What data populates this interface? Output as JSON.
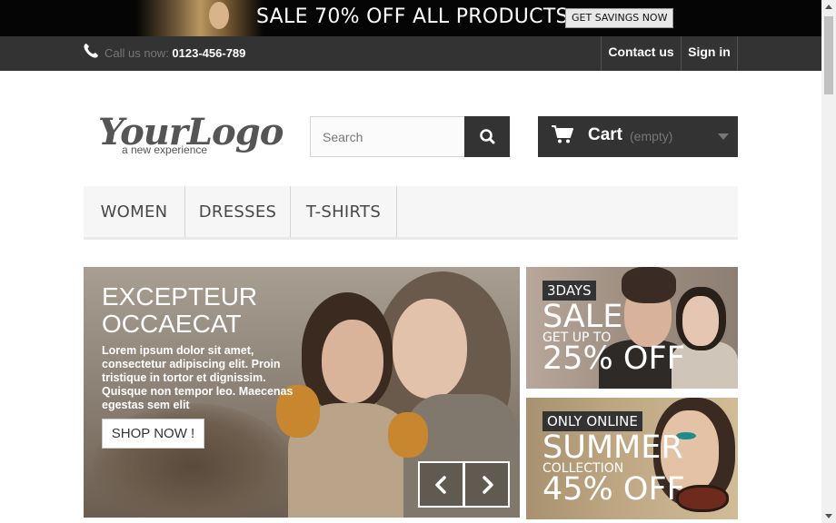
{
  "promo": {
    "text": "SALE 70% OFF ALL PRODUCTS",
    "button": "GET SAVINGS NOW"
  },
  "topnav": {
    "call_label": "Call us now: ",
    "phone_number": "0123-456-789",
    "contact": "Contact us",
    "signin": "Sign in"
  },
  "logo": {
    "name": "YourLogo",
    "tagline": "a new experience"
  },
  "search": {
    "placeholder": "Search"
  },
  "cart": {
    "label": "Cart",
    "status": "(empty)"
  },
  "menu": {
    "items": [
      "WOMEN",
      "DRESSES",
      "T-SHIRTS"
    ]
  },
  "hero": {
    "title_line1": "EXCEPTEUR",
    "title_line2": "OCCAECAT",
    "description": "Lorem ipsum dolor sit amet, consectetur adipiscing elit. Proin tristique in tortor et dignissim. Quisque non tempor leo. Maecenas egestas sem elit",
    "button": "SHOP NOW !"
  },
  "banners": [
    {
      "tag": "3DAYS",
      "headline": "SALE",
      "sub": "GET UP TO",
      "offer": "25% OFF"
    },
    {
      "tag": "ONLY ONLINE",
      "headline": "SUMMER",
      "sub": "COLLECTION",
      "offer": "45% OFF"
    }
  ],
  "colors": {
    "dark": "#333333",
    "menu_bg": "#f6f6f6",
    "promo_bg": "#050505"
  },
  "icons": [
    "phone-icon",
    "search-icon",
    "cart-icon",
    "chevron-down-icon",
    "chevron-left-icon",
    "chevron-right-icon"
  ]
}
